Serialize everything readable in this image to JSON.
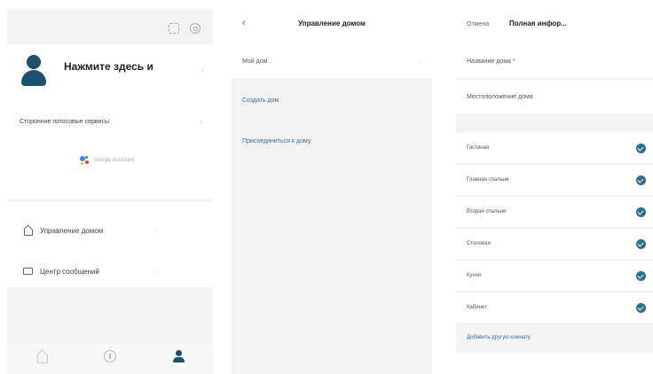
{
  "panel1": {
    "profile": {
      "name": "Нажмите здесь и",
      "subtitle": ""
    },
    "voice": {
      "title": "Сторонние голосовые сервисы",
      "assistant_label": "Google Assistant"
    },
    "menu": [
      {
        "label": "Управление домом"
      },
      {
        "label": "Центр сообщений"
      }
    ],
    "tabs": [
      {
        "label": ""
      },
      {
        "label": ""
      },
      {
        "label": ""
      }
    ],
    "colors": {
      "accent": "#1d4f6e"
    }
  },
  "panel2": {
    "title": "Управление домом",
    "my_home": "Мой дом .",
    "create_home": "Создать дом",
    "join_home": "Присоединиться к дому",
    "colors": {
      "link": "#3a6ea5"
    }
  },
  "panel3": {
    "cancel": "Отмена",
    "title": "Полная инфор...",
    "home_name_label": "Название дома *",
    "home_name_value": "",
    "location_label": "Местоположение дома",
    "location_value": "",
    "rooms_section": "",
    "rooms": [
      {
        "name": "Гостиная",
        "checked": true
      },
      {
        "name": "Главная спальня",
        "checked": true
      },
      {
        "name": "Вторая спальня",
        "checked": true
      },
      {
        "name": "Столовая",
        "checked": true
      },
      {
        "name": "Кухня",
        "checked": true
      },
      {
        "name": "Кабинет",
        "checked": true
      }
    ],
    "add_room": "Добавить другую комнату",
    "colors": {
      "check": "#2e6d8e"
    }
  },
  "icons": {
    "scan": "scan-icon",
    "settings": "settings-icon",
    "google_assistant": "google-assistant-icon",
    "home": "house-icon",
    "messages": "message-icon",
    "back": "back-chevron-icon",
    "check": "check-circle-icon"
  }
}
